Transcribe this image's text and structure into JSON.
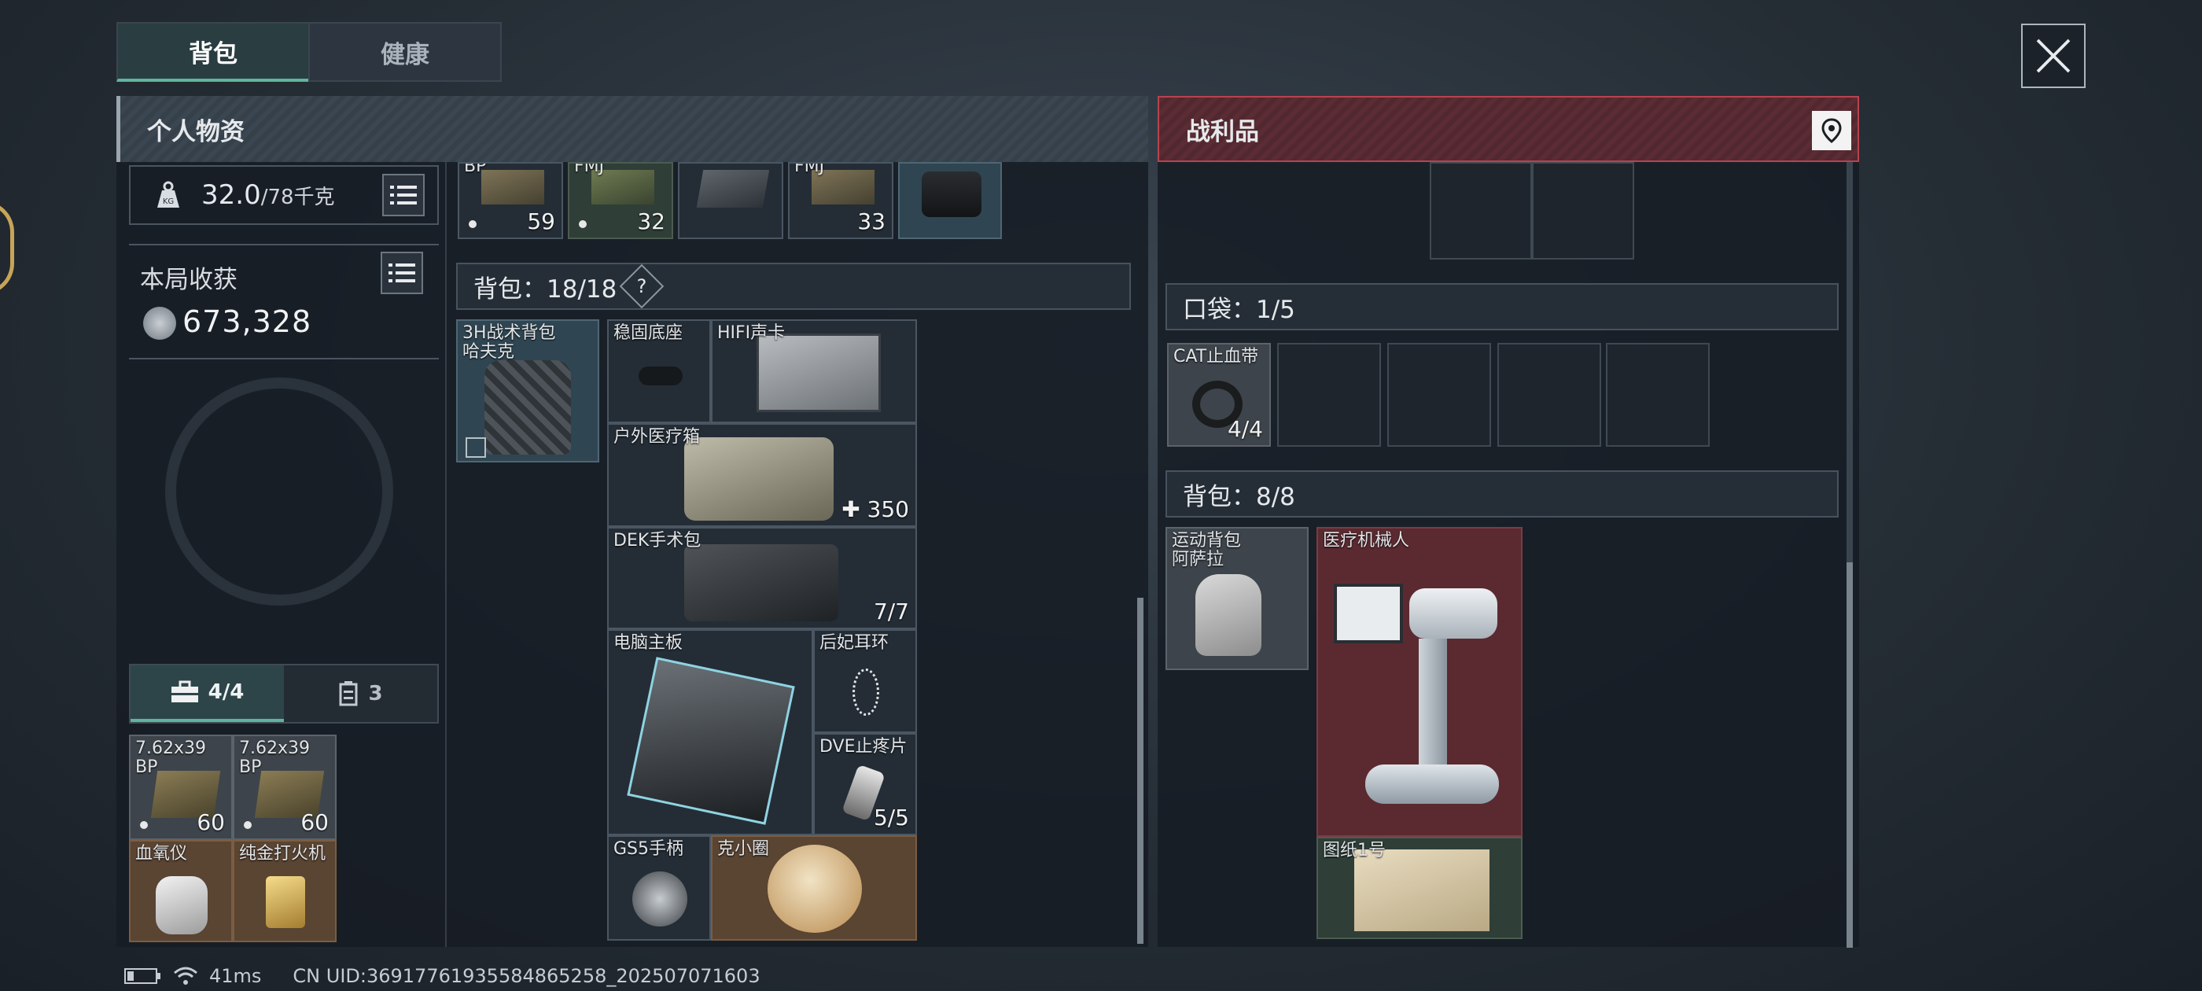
{
  "tabs": [
    {
      "label": "背包",
      "active": true
    },
    {
      "label": "健康",
      "active": false
    }
  ],
  "left_panel": {
    "title": "个人物资",
    "weight_value": "32.0",
    "weight_max": "/78千克",
    "harvest_label": "本局收获",
    "harvest_value": "673,328",
    "sub_tabs": [
      {
        "icon": "toolbox-icon",
        "label": "4/4"
      },
      {
        "icon": "container-icon",
        "label": "3"
      }
    ],
    "bottom_items": [
      {
        "name": "7.62x39\nBP",
        "count": "60"
      },
      {
        "name": "7.62x39\nBP",
        "count": "60"
      },
      {
        "name": "血氧仪",
        "count": ""
      },
      {
        "name": "纯金打火机",
        "count": ""
      }
    ],
    "top_row_items": [
      {
        "name": "BP",
        "count": "59"
      },
      {
        "name": "FMJ",
        "count": "32"
      },
      {
        "name": "",
        "count": ""
      },
      {
        "name": "FMJ",
        "count": "33"
      },
      {
        "name": "",
        "count": ""
      }
    ],
    "backpack_label": "背包：18/18",
    "backpack_help": "?",
    "backpack_items": [
      {
        "name": "3H战术背包\n哈夫克",
        "count": ""
      },
      {
        "name": "稳固底座",
        "count": ""
      },
      {
        "name": "HIFI声卡",
        "count": ""
      },
      {
        "name": "户外医疗箱",
        "count": "✚ 350"
      },
      {
        "name": "DEK手术包",
        "count": "7/7"
      },
      {
        "name": "电脑主板",
        "count": ""
      },
      {
        "name": "后妃耳环",
        "count": ""
      },
      {
        "name": "DVE止疼片",
        "count": "5/5"
      },
      {
        "name": "GS5手柄",
        "count": ""
      },
      {
        "name": "克小圈",
        "count": ""
      }
    ]
  },
  "right_panel": {
    "title": "战利品",
    "pocket_label": "口袋：1/5",
    "pocket_items": [
      {
        "name": "CAT止血带",
        "count": "4/4"
      }
    ],
    "backpack_label": "背包：8/8",
    "backpack_items": [
      {
        "name": "运动背包\n阿萨拉",
        "count": ""
      },
      {
        "name": "医疗机械人",
        "count": ""
      },
      {
        "name": "图纸1号",
        "count": ""
      }
    ]
  },
  "status_bar": {
    "ping": "41ms",
    "uid": "CN UID:36917761935584865258_202507071603"
  },
  "colors": {
    "accent_teal": "#5fb59c",
    "loot_red": "#b8434f",
    "rarity_red": "#5a2a30",
    "rarity_gold": "#5a4432",
    "rarity_teal": "#2f4652"
  }
}
